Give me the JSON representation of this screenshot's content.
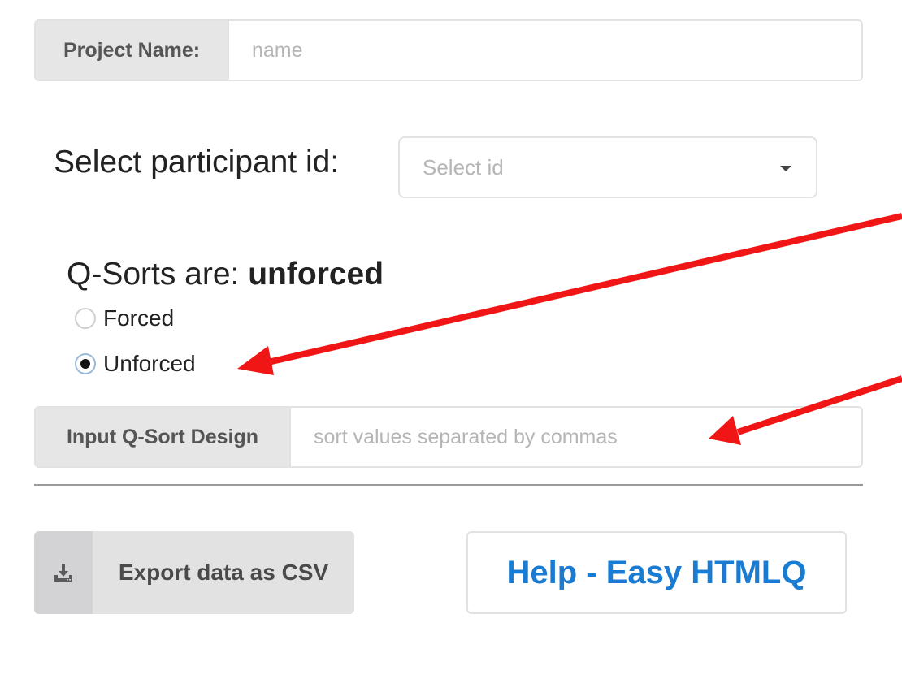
{
  "project": {
    "label": "Project Name:",
    "placeholder": "name",
    "value": ""
  },
  "participant": {
    "label": "Select participant id:",
    "placeholder": "Select id"
  },
  "qsort": {
    "title_prefix": "Q-Sorts are: ",
    "title_value": "unforced",
    "options": [
      {
        "label": "Forced",
        "checked": false
      },
      {
        "label": "Unforced",
        "checked": true
      }
    ]
  },
  "design": {
    "label": "Input Q-Sort Design",
    "placeholder": "sort values separated by commas",
    "value": ""
  },
  "actions": {
    "export_label": "Export data as CSV",
    "export_icon": "download-icon",
    "help_label": "Help - Easy HTMLQ"
  },
  "colors": {
    "annotation_arrow": "#f01616",
    "help_text": "#1a7bd2",
    "addon_bg": "#e6e6e6"
  }
}
